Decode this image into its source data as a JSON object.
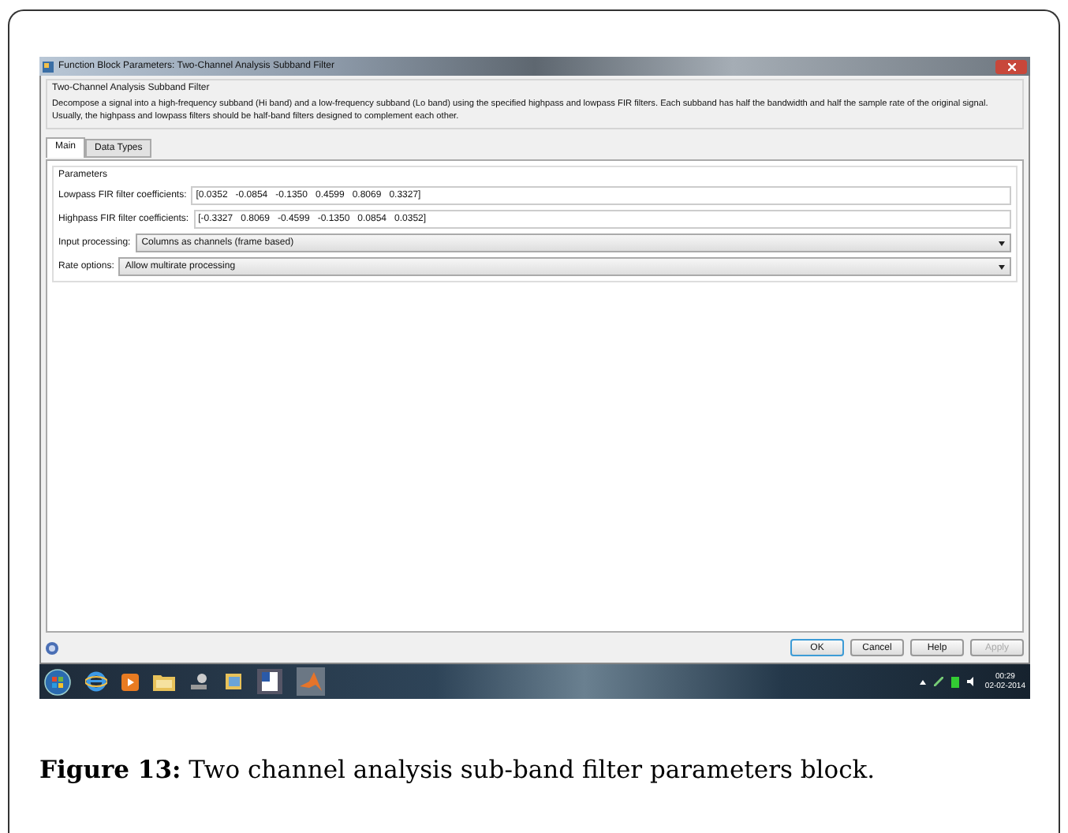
{
  "window": {
    "title": "Function Block Parameters: Two-Channel Analysis Subband Filter"
  },
  "block": {
    "title": "Two-Channel Analysis Subband Filter",
    "description": "Decompose a signal into a high-frequency subband (Hi band) and a low-frequency subband (Lo band) using the specified highpass and lowpass FIR filters.  Each subband has half the bandwidth and half the sample rate of the original signal.  Usually, the highpass and lowpass filters should be half-band filters designed to complement each other."
  },
  "tabs": [
    {
      "label": "Main",
      "selected": true
    },
    {
      "label": "Data Types",
      "selected": false
    }
  ],
  "parameters": {
    "title": "Parameters",
    "fields": [
      {
        "kind": "text",
        "label": "Lowpass FIR filter coefficients:",
        "value": "[0.0352   -0.0854   -0.1350   0.4599   0.8069   0.3327]"
      },
      {
        "kind": "text",
        "label": "Highpass FIR filter coefficients:",
        "value": "[-0.3327   0.8069   -0.4599   -0.1350   0.0854   0.0352]"
      },
      {
        "kind": "dropdown",
        "label": "Input processing:",
        "value": "Columns as channels (frame based)"
      },
      {
        "kind": "dropdown",
        "label": "Rate options:",
        "value": "Allow multirate processing"
      }
    ]
  },
  "buttons": [
    {
      "label": "OK",
      "disabled": false,
      "default": true
    },
    {
      "label": "Cancel",
      "disabled": false,
      "default": false
    },
    {
      "label": "Help",
      "disabled": false,
      "default": false
    },
    {
      "label": "Apply",
      "disabled": true,
      "default": false
    }
  ],
  "taskbar": {
    "time": "00:29",
    "date": "02-02-2014"
  },
  "caption": "**Figure 13:** Two channel analysis sub-band filter parameters block."
}
